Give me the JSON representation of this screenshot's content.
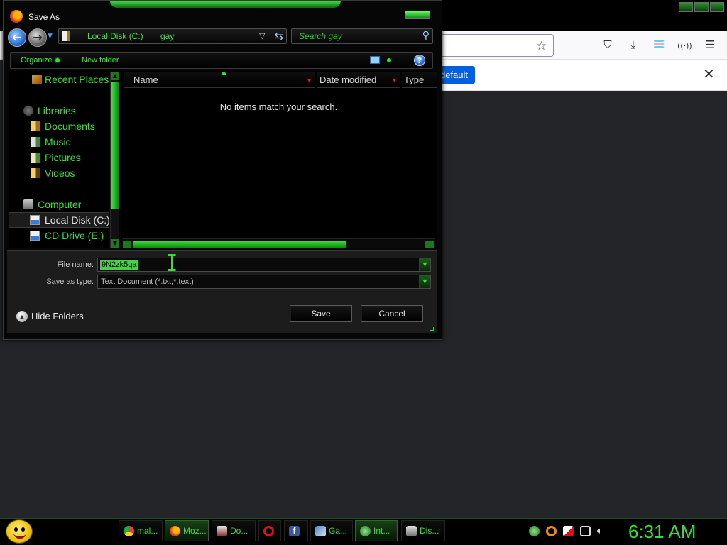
{
  "dialog": {
    "title": "Save As",
    "address": {
      "segments": [
        "Local Disk (C:)",
        "gay"
      ]
    },
    "search": {
      "placeholder": "Search gay"
    },
    "toolbar": {
      "organize": "Organize",
      "new_folder": "New folder",
      "help": "?"
    },
    "nav": {
      "items": [
        {
          "label": "Recent Places",
          "icon": "recent-places-icon"
        },
        {
          "label": "Libraries",
          "icon": "libraries-icon"
        },
        {
          "label": "Documents",
          "icon": "documents-icon"
        },
        {
          "label": "Music",
          "icon": "music-icon"
        },
        {
          "label": "Pictures",
          "icon": "pictures-icon"
        },
        {
          "label": "Videos",
          "icon": "videos-icon"
        },
        {
          "label": "Computer",
          "icon": "computer-icon"
        },
        {
          "label": "Local Disk (C:)",
          "icon": "drive-icon",
          "selected": true
        },
        {
          "label": "CD Drive (E:)",
          "icon": "cd-drive-icon"
        }
      ]
    },
    "columns": [
      "Name",
      "Date modified",
      "Type"
    ],
    "empty_message": "No items match your search.",
    "file_name": {
      "label": "File name:",
      "value": "9N2zk5qa"
    },
    "save_as_type": {
      "label": "Save as type:",
      "value": "Text Document (*.txt;*.text)"
    },
    "hide_folders": "Hide Folders",
    "save_button": "Save",
    "cancel_button": "Cancel"
  },
  "browser": {
    "notification_button": "default",
    "toolbar_icons": [
      "star-icon",
      "pocket-icon",
      "download-icon",
      "profile-icon",
      "extensions-icon",
      "menu-icon"
    ]
  },
  "taskbar": {
    "tasks": [
      {
        "label": "mal...",
        "icon": "chrome-icon",
        "color": "#dd4433"
      },
      {
        "label": "Moz...",
        "icon": "firefox-icon",
        "color": "#e86a1a",
        "active": true
      },
      {
        "label": "Do...",
        "icon": "document-icon",
        "color": "#c0c0c0"
      },
      {
        "label": "",
        "icon": "opera-icon",
        "color": "#e01010"
      },
      {
        "label": "",
        "icon": "facebook-icon",
        "color": "#3b5998"
      },
      {
        "label": "Ga...",
        "icon": "gallery-icon",
        "color": "#4a8ad0"
      },
      {
        "label": "Int...",
        "icon": "internet-icon",
        "color": "#3ab03a",
        "active": true
      },
      {
        "label": "Dis...",
        "icon": "disk-icon",
        "color": "#b0b0b0"
      }
    ],
    "clock": "6:31 AM"
  }
}
